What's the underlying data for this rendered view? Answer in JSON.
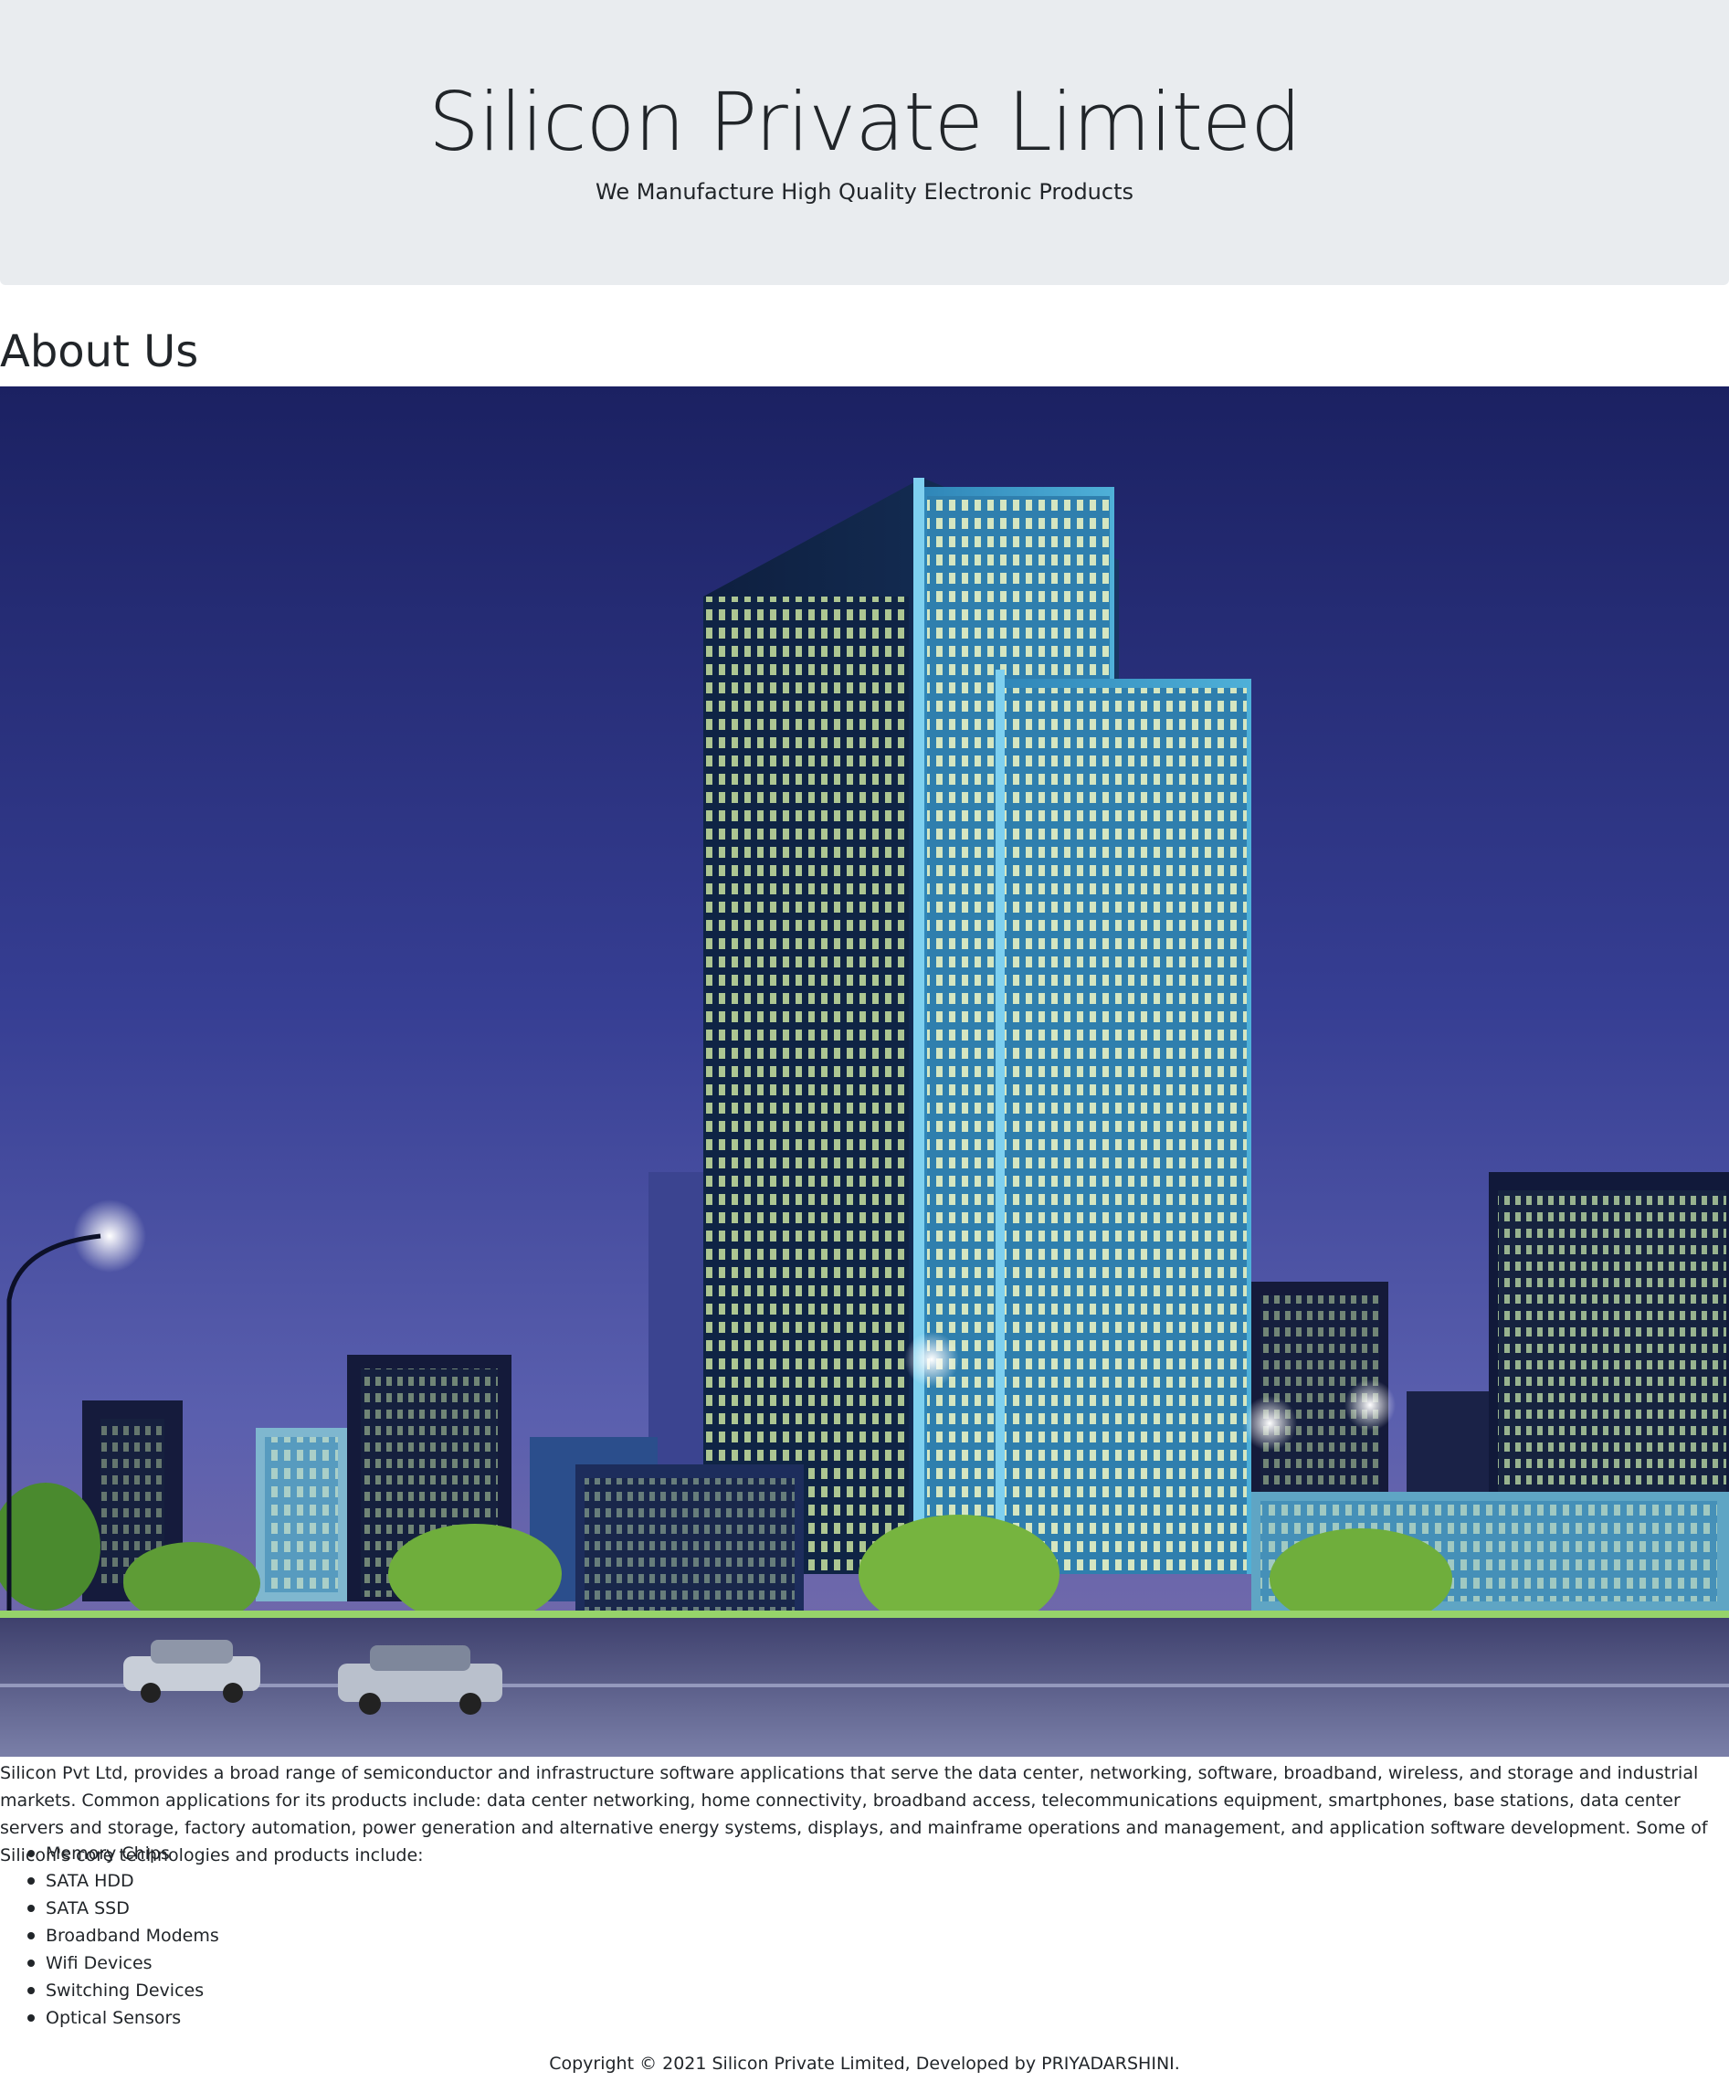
{
  "header": {
    "title": "Silicon Private Limited",
    "tagline": "We Manufacture High Quality Electronic Products"
  },
  "about": {
    "heading": "About Us",
    "paragraph": "Silicon Pvt Ltd, provides a broad range of semiconductor and infrastructure software applications that serve the data center, networking, software, broadband, wireless, and storage and industrial markets. Common applications for its products include: data center networking, home connectivity, broadband access, telecommunications equipment, smartphones, base stations, data center servers and storage, factory automation, power generation and alternative energy systems, displays, and mainframe operations and management, and application software development. Some of Silicon's core technologies and products include:",
    "products": [
      "Memory Chips",
      "SATA HDD",
      "SATA SSD",
      "Broadband Modems",
      "Wifi Devices",
      "Switching Devices",
      "Optical Sensors"
    ]
  },
  "footer": {
    "copyright": "Copyright © 2021 Silicon Private Limited, Developed by PRIYADARSHINI."
  },
  "colors": {
    "jumbotron_bg": "#e9ecef",
    "text": "#212529",
    "sky_top": "#1d2466",
    "sky_bottom": "#6a70b8"
  }
}
